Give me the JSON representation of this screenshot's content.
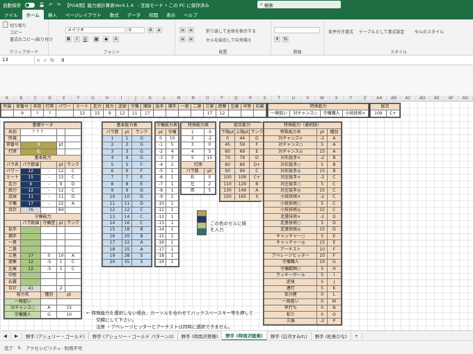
{
  "titlebar": {
    "autosave": "自動保存",
    "filename": "【PG8用】能力値計算表Ver4.1.4",
    "mode": "- 互換モード • この PC に保存済み",
    "search_placeholder": "検索"
  },
  "menu": [
    "ァイル",
    "ホーム",
    "挿入",
    "ページレイアウト",
    "数式",
    "データ",
    "校閲",
    "表示",
    "ヘルプ"
  ],
  "ribbon": {
    "clipboard": {
      "label": "クリップボード",
      "cut": "切り取り",
      "copy": "コピー",
      "format_painter": "書式のコピー/貼り付け"
    },
    "font": {
      "label": "フォント",
      "name": "メイリオ",
      "size": "9",
      "bold": "B",
      "italic": "I",
      "underline": "U"
    },
    "align": {
      "label": "配置",
      "wrap": "折り返して全体を表示する",
      "merge": "セルを結合して中央揃え"
    },
    "number": {
      "label": "数値"
    },
    "style": {
      "label": "スタイル",
      "cond": "条件付き書式",
      "table": "テーブルとして書式設定",
      "cell": "セルのスタイル"
    }
  },
  "formula": {
    "namebox": "13",
    "cancel": "×",
    "enter": "✓",
    "fx": "fx",
    "value": "9"
  },
  "columns": [
    "A",
    "B",
    "C",
    "D",
    "E",
    "F",
    "G",
    "H",
    "I",
    "J",
    "K",
    "L",
    "M",
    "N",
    "O",
    "P",
    "Q",
    "R",
    "S",
    "T",
    "U",
    "V",
    "W",
    "X",
    "Y",
    "Z",
    "AA",
    "AB",
    "AC",
    "AD",
    "AE",
    "AF",
    "AG"
  ],
  "summary": {
    "headers": [
      "所属",
      "背番号",
      "名前",
      "打席",
      "パワー",
      "ミート",
      "走力",
      "肩力",
      "送球",
      "守備",
      "捕球",
      "投手",
      "捕手",
      "一塁",
      "二塁",
      "三塁",
      "遊撃",
      "左翼",
      "中堅",
      "右翼"
    ],
    "values": [
      "",
      "9",
      "?",
      "?",
      "",
      "12",
      "15",
      "9",
      "12",
      "11",
      "17",
      "",
      "",
      "",
      "",
      "17",
      "12",
      "",
      "",
      ""
    ],
    "special_label": "特殊能力",
    "special_items": [
      "一発狙い",
      "対チャンス○",
      "守備職人",
      "小技技術×"
    ],
    "total_label": "総合",
    "total": "109",
    "rank": "C+"
  },
  "basic": {
    "title": "基礎データ",
    "rows": [
      [
        "名前",
        "？？？"
      ],
      [
        "所属",
        ""
      ],
      [
        "背番号",
        "9"
      ],
      [
        "打席",
        "右"
      ]
    ],
    "pt": "pt",
    "ability_title": "基本能力",
    "ability_header": [
      "パラ名",
      "パラ数値",
      "",
      "pt",
      "ランク"
    ],
    "ability_rows": [
      [
        "パワー",
        "12",
        "-",
        "12",
        "C"
      ],
      [
        "ミート",
        "15",
        "-",
        "15",
        "C"
      ],
      [
        "走力",
        "9",
        "-",
        "9",
        "D"
      ],
      [
        "肩力",
        "12",
        "-",
        "12",
        "C"
      ],
      [
        "送球",
        "11",
        "-",
        "11",
        "D"
      ],
      [
        "守備",
        "17",
        "-",
        "22",
        "A"
      ],
      [
        "合計",
        "76",
        "",
        "84",
        ""
      ]
    ],
    "fielding_title": "守備能力",
    "fielding_header": [
      "",
      "パラ数値",
      "守備歪",
      "pt",
      "ランク"
    ],
    "fielding_rows": [
      [
        "投手",
        "",
        "",
        "",
        ""
      ],
      [
        "捕手",
        "",
        "",
        "",
        ""
      ],
      [
        "一塁",
        "",
        "",
        "",
        ""
      ],
      [
        "二塁",
        "",
        "",
        "",
        ""
      ],
      [
        "三塁",
        "17",
        "0",
        "10",
        "A"
      ],
      [
        "遊撃",
        "12",
        "-5",
        "1",
        "C"
      ],
      [
        "左翼",
        "12",
        "-5",
        "1",
        "C"
      ],
      [
        "中堅",
        "",
        "",
        "",
        ""
      ],
      [
        "右翼",
        "",
        "",
        "",
        ""
      ],
      [
        "合計",
        "41",
        "",
        "2",
        ""
      ]
    ],
    "special_header": [
      "能力名",
      "種別",
      "pt"
    ],
    "special_rows": [
      [
        "一発狙い",
        "",
        ""
      ],
      [
        "対チャンス○",
        "A",
        "15"
      ],
      [
        "守備職人",
        "G",
        "10"
      ]
    ]
  },
  "basic_table": {
    "title": "基本能力表",
    "header": [
      "パラ数",
      "pt",
      "ランク"
    ],
    "rows": [
      [
        "1",
        "1",
        "G"
      ],
      [
        "2",
        "2",
        "G"
      ],
      [
        "3",
        "3",
        "G"
      ],
      [
        "4",
        "4",
        "G"
      ],
      [
        "5",
        "5",
        "F"
      ],
      [
        "6",
        "6",
        "F"
      ],
      [
        "7",
        "7",
        "E"
      ],
      [
        "8",
        "8",
        "E"
      ],
      [
        "9",
        "9",
        "D"
      ],
      [
        "10",
        "10",
        "D"
      ],
      [
        "11",
        "11",
        "D"
      ],
      [
        "12",
        "12",
        "C"
      ],
      [
        "13",
        "14",
        "C"
      ],
      [
        "14",
        "16",
        "C"
      ],
      [
        "15",
        "18",
        "B"
      ],
      [
        "16",
        "20",
        "B"
      ],
      [
        "17",
        "22",
        "A"
      ],
      [
        "18",
        "25",
        "A"
      ],
      [
        "19",
        "28",
        "S"
      ],
      [
        "20",
        "35",
        "S"
      ]
    ]
  },
  "fielding_table": {
    "title": "守備能力表",
    "header": [
      "pt",
      "守備"
    ],
    "rows": [
      [
        "0",
        "10"
      ],
      [
        "-1",
        "5"
      ],
      [
        "-2",
        "4"
      ],
      [
        "-3",
        "3"
      ],
      [
        "-4",
        "2"
      ],
      [
        "-5",
        "1"
      ],
      [
        "-6",
        "1"
      ],
      [
        "-7",
        "1"
      ],
      [
        "-8",
        "1"
      ],
      [
        "-9",
        "1"
      ],
      [
        "-10",
        "1"
      ],
      [
        "-11",
        "1"
      ],
      [
        "-12",
        "1"
      ],
      [
        "-13",
        "1"
      ],
      [
        "-14",
        "1"
      ],
      [
        "-15",
        "1"
      ],
      [
        "-16",
        "1"
      ],
      [
        "-17",
        "1"
      ],
      [
        "-18",
        "1"
      ],
      [
        "-19",
        "1"
      ]
    ]
  },
  "special_table": {
    "title": "特殊能力表",
    "rows": [
      [
        "1",
        "-5"
      ],
      [
        "2",
        "-2"
      ],
      [
        "3",
        "0"
      ],
      [
        "4",
        "5"
      ],
      [
        "5",
        "15"
      ]
    ],
    "bat_title": "打席",
    "bat_header": [
      "パラ数",
      "pt"
    ],
    "bat_rows": [
      [
        "右",
        "0"
      ],
      [
        "左",
        "2"
      ],
      [
        "両",
        "5"
      ]
    ]
  },
  "total_table": {
    "title": "総合能力",
    "header": [
      "下限pt",
      "上限pt",
      "ランク"
    ],
    "rows": [
      [
        "0",
        "44",
        "G"
      ],
      [
        "45",
        "59",
        "F"
      ],
      [
        "60",
        "69",
        "E"
      ],
      [
        "70",
        "79",
        "D"
      ],
      [
        "80",
        "89",
        "D+"
      ],
      [
        "90",
        "99",
        "C"
      ],
      [
        "100",
        "109",
        "C+"
      ],
      [
        "110",
        "129",
        "B"
      ],
      [
        "130",
        "149",
        "A"
      ],
      [
        "150",
        "165",
        "S"
      ]
    ]
  },
  "special_select": {
    "title": "特殊能力（選択肢）",
    "header": [
      "特殊能力名",
      "pt",
      "種別"
    ],
    "rows": [
      [
        "対チャンス×",
        "-2",
        "A"
      ],
      [
        "対チャンス○",
        "5",
        "A"
      ],
      [
        "対チャンス◎",
        "15",
        "A"
      ],
      [
        "対右投手×",
        "-2",
        "B"
      ],
      [
        "対右投手○",
        "5",
        "B"
      ],
      [
        "対右投手◎",
        "15",
        "B"
      ],
      [
        "対左投手×",
        "-2",
        "C"
      ],
      [
        "対左投手○",
        "5",
        "C"
      ],
      [
        "対左投手◎",
        "15",
        "C"
      ],
      [
        "小技技術×",
        "-2",
        "C"
      ],
      [
        "小技技術○",
        "5",
        "C"
      ],
      [
        "小技技術◎",
        "15",
        "C"
      ],
      [
        "走塁技術×",
        "-2",
        "D"
      ],
      [
        "走塁技術○",
        "5",
        "D"
      ],
      [
        "走塁技術◎",
        "15",
        "D"
      ],
      [
        "キャッチャー○",
        "5",
        "E"
      ],
      [
        "キャッチャー◎",
        "15",
        "E"
      ],
      [
        "アーチスト",
        "10",
        "F"
      ],
      [
        "アベレージヒッター",
        "10",
        "F"
      ],
      [
        "守備職人",
        "10",
        "G"
      ],
      [
        "守備範囲○",
        "5",
        "H"
      ],
      [
        "ラッキーガール",
        "5",
        "I"
      ],
      [
        "逆境",
        "5",
        "J"
      ],
      [
        "連打",
        "5",
        "K"
      ],
      [
        "気分屋",
        "0",
        "L"
      ],
      [
        "一発狙い",
        "0",
        "M"
      ],
      [
        "早打ち",
        "0",
        "N"
      ],
      [
        "粘り",
        "0",
        "O"
      ],
      [
        "三振",
        "-2",
        "P"
      ]
    ]
  },
  "notes": {
    "swatch": "この色のセルに値を入力",
    "note1": "← 特殊能力を選択しない場合、カーソルを合わせてバックスペースキー等を押して",
    "note2": "空欄にして下さい。",
    "note3": "注意 ・アベレージヒッターとアーチストは同時に選択できません。"
  },
  "colors": {
    "tan": "#f3dcc4",
    "blue": "#c8dcef",
    "gold": "#b3a44e",
    "navy": "#203864",
    "green": "#c6dbaa",
    "excel": "#1f6e43"
  },
  "tabs": [
    "野手 (アシュリー・ゴールド)",
    "野手 (アシュリー・ゴールド パターン2)",
    "野手 (時雨沢美穂)",
    "野手 (時雨沢睦美)",
    "野手 (白河すみれ)",
    "野手 (松島ひな)"
  ],
  "active_tab": 3,
  "status": {
    "ready": "完了",
    "access": "アクセシビリティ: 利用不可"
  }
}
